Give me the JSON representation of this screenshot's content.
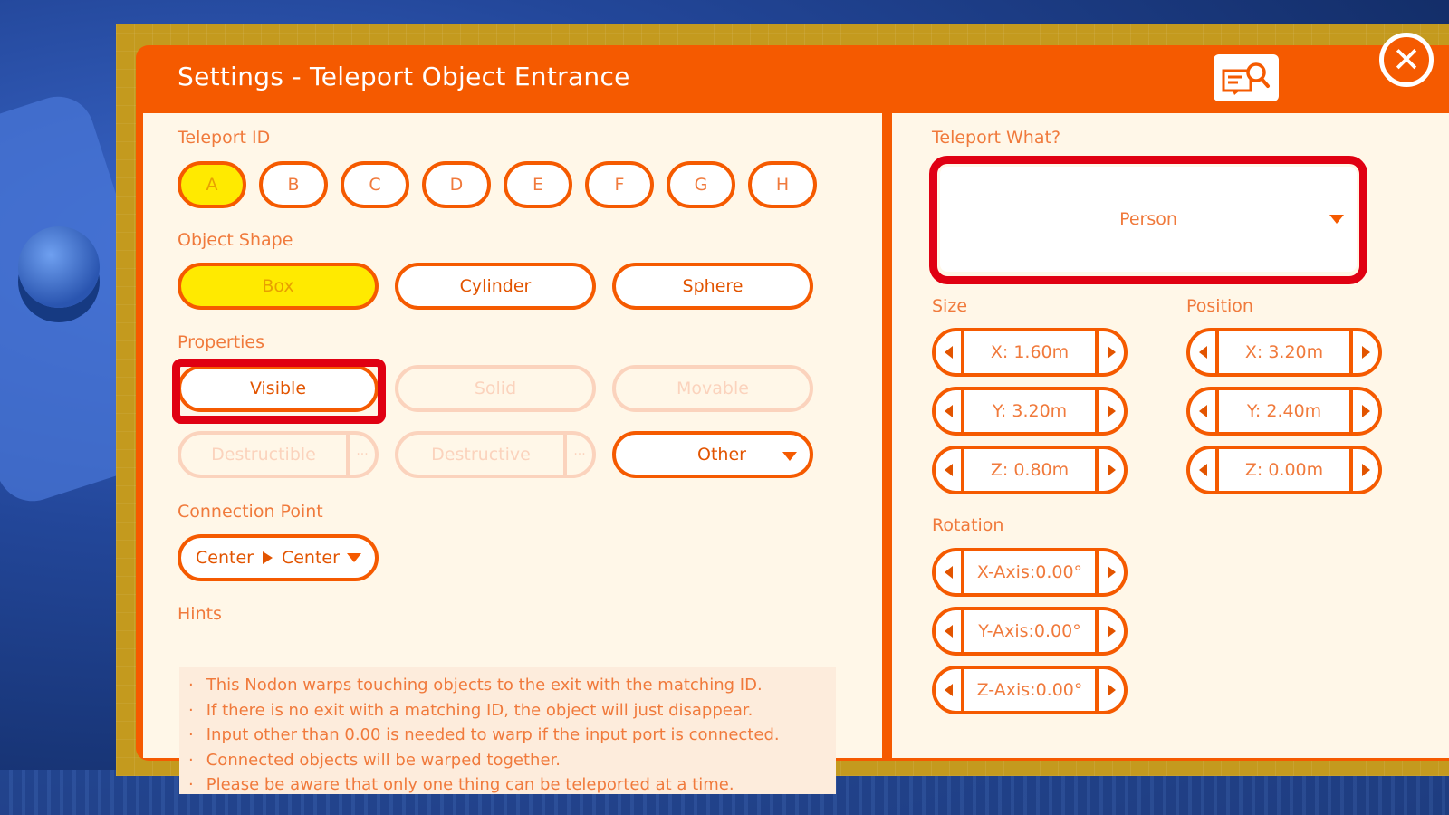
{
  "window": {
    "title": "Settings - Teleport Object Entrance"
  },
  "teleport_id": {
    "label": "Teleport ID",
    "options": [
      "A",
      "B",
      "C",
      "D",
      "E",
      "F",
      "G",
      "H"
    ],
    "selected": "A"
  },
  "object_shape": {
    "label": "Object Shape",
    "options": [
      "Box",
      "Cylinder",
      "Sphere"
    ],
    "selected": "Box"
  },
  "properties": {
    "label": "Properties",
    "visible": "Visible",
    "solid": "Solid",
    "movable": "Movable",
    "destructible": "Destructible",
    "destructive": "Destructive",
    "more": "···",
    "other": "Other"
  },
  "connection_point": {
    "label": "Connection Point",
    "from": "Center",
    "to": "Center"
  },
  "hints": {
    "label": "Hints",
    "items": [
      "This Nodon warps touching objects to the exit with the matching ID.",
      "If there is no exit with a matching ID, the object will just disappear.",
      "Input other than 0.00 is needed to warp if the input port is connected.",
      "Connected objects will be warped together.",
      "Please be aware that only one thing can be teleported at a time."
    ]
  },
  "teleport_what": {
    "label": "Teleport What?",
    "value": "Person"
  },
  "size": {
    "label": "Size",
    "x": "X: 1.60m",
    "y": "Y: 3.20m",
    "z": "Z: 0.80m"
  },
  "position": {
    "label": "Position",
    "x": "X: 3.20m",
    "y": "Y: 2.40m",
    "z": "Z: 0.00m"
  },
  "rotation": {
    "label": "Rotation",
    "x": "X-Axis:0.00°",
    "y": "Y-Axis:0.00°",
    "z": "Z-Axis:0.00°"
  },
  "colors": {
    "accent": "#f55a00",
    "selected": "#ffea00",
    "highlight": "#e00012",
    "panel": "#fff7e8"
  },
  "icons": {
    "help": "help-search-icon",
    "close": "close-icon"
  }
}
